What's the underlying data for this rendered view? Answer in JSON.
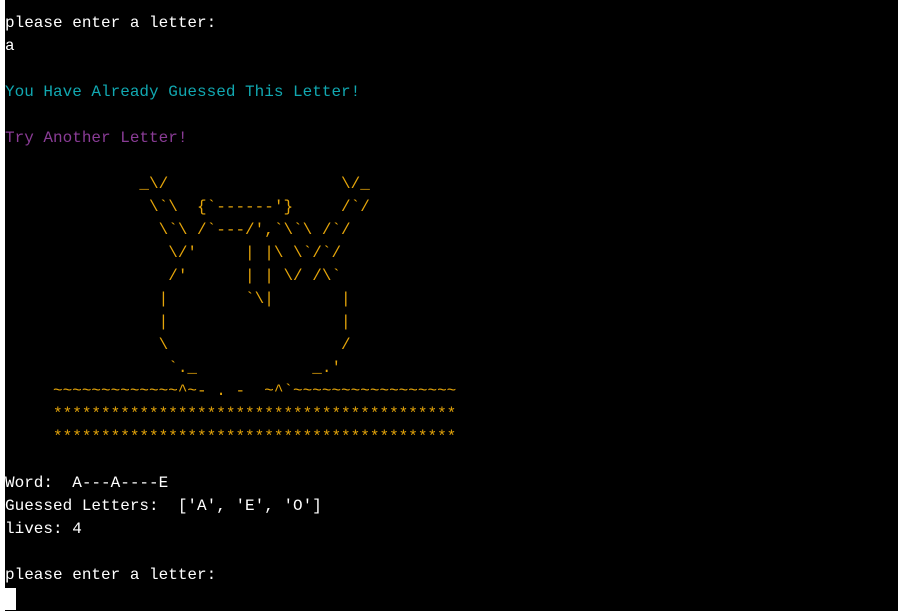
{
  "colors": {
    "background": "#000000",
    "default_text": "#ffffff",
    "already_guessed": "#11a8b1",
    "try_another": "#8a3c96",
    "ascii_art": "#e5a50a"
  },
  "prompt_1": "please enter a letter:",
  "user_input": "a",
  "already_guessed_message": "You Have Already Guessed This Letter!",
  "try_another_message": "Try Another Letter!",
  "ascii_art": [
    "              _\\/                  \\/_",
    "               \\`\\  {`------'}     /`/",
    "                \\`\\ /`---/',`\\`\\ /`/",
    "                 \\/'     | |\\ \\`/`/",
    "                 /'      | | \\/ /\\`",
    "                |        `\\|       |",
    "                |                  |",
    "                \\                  /",
    "                 `._            _.'",
    "     ~~~~~~~~~~~~~^~- . -  ~^`~~~~~~~~~~~~~~~~~",
    "     ******************************************",
    "     ******************************************"
  ],
  "word_label": "Word:  A---A----E",
  "guessed_letters_label": "Guessed Letters:  ['A', 'E', 'O']",
  "lives_label": "lives: 4",
  "prompt_2": "please enter a letter:"
}
